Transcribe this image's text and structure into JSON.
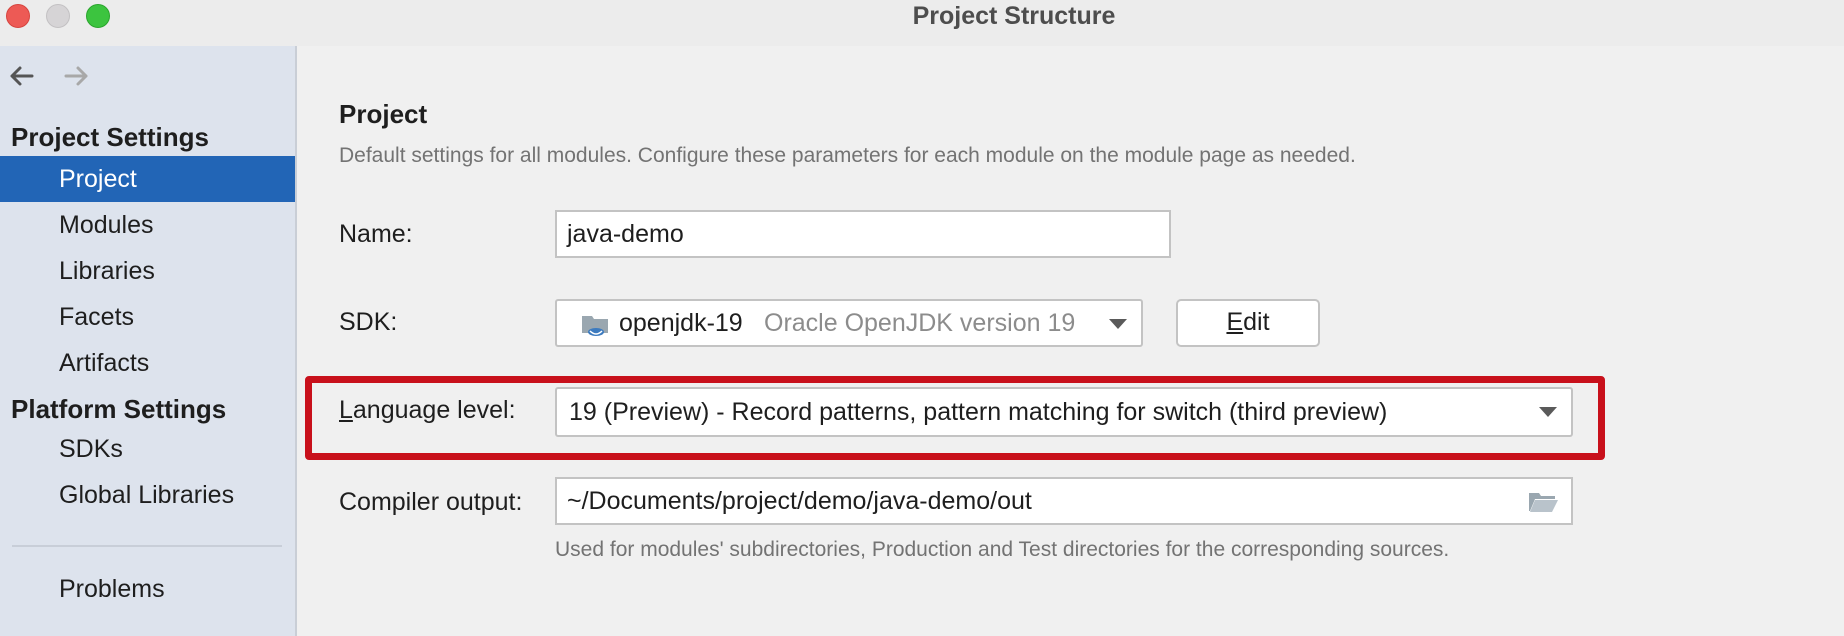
{
  "window": {
    "title": "Project Structure"
  },
  "sidebar": {
    "project_settings_heading": "Project Settings",
    "project_items": [
      {
        "label": "Project",
        "selected": true
      },
      {
        "label": "Modules"
      },
      {
        "label": "Libraries"
      },
      {
        "label": "Facets"
      },
      {
        "label": "Artifacts"
      }
    ],
    "platform_settings_heading": "Platform Settings",
    "platform_items": [
      {
        "label": "SDKs"
      },
      {
        "label": "Global Libraries"
      }
    ],
    "problems_label": "Problems"
  },
  "main": {
    "title": "Project",
    "description": "Default settings for all modules. Configure these parameters for each module on the module page as needed.",
    "name": {
      "label": "Name:",
      "value": "java-demo"
    },
    "sdk": {
      "label": "SDK:",
      "selected_name": "openjdk-19",
      "selected_detail": "Oracle OpenJDK version 19",
      "edit_label_prefix": "",
      "edit_mnemonic": "E",
      "edit_label_rest": "dit"
    },
    "language_level": {
      "label_mnemonic": "L",
      "label_rest": "anguage level:",
      "value": "19 (Preview) - Record patterns, pattern matching for switch (third preview)"
    },
    "compiler_output": {
      "label": "Compiler output:",
      "value": "~/Documents/project/demo/java-demo/out",
      "hint": "Used for modules' subdirectories, Production and Test directories for the corresponding sources."
    }
  },
  "colors": {
    "selection": "#2265b6",
    "highlight_border": "#c8101b",
    "sidebar_bg": "#dde3ed"
  }
}
